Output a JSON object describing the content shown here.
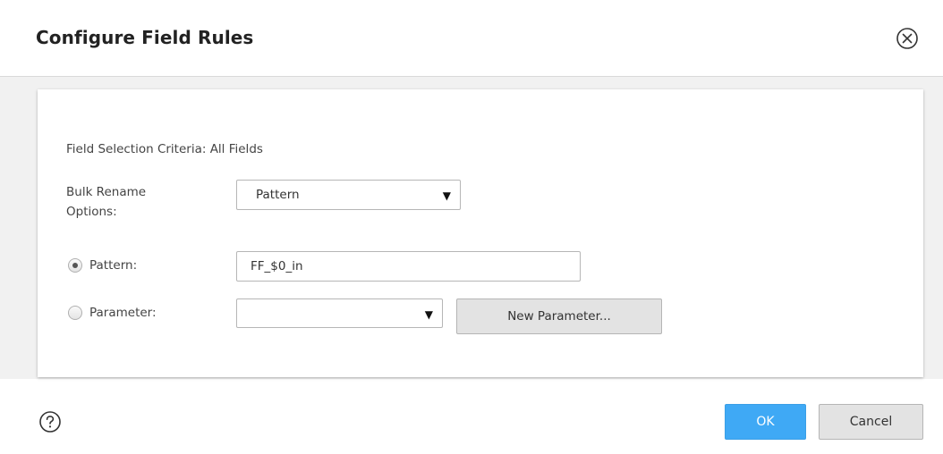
{
  "dialog": {
    "title": "Configure Field Rules",
    "close_icon": "close-circle-icon"
  },
  "form": {
    "field_selection_criteria": "Field Selection Criteria: All Fields",
    "bulk_rename_label": "Bulk Rename Options:",
    "bulk_rename_selected": "Pattern",
    "pattern_label": "Pattern:",
    "pattern_selected": true,
    "pattern_value": "FF_$0_in",
    "parameter_label": "Parameter:",
    "parameter_selected": false,
    "parameter_value": "",
    "new_parameter_label": "New Parameter..."
  },
  "footer": {
    "help_icon": "help-circle-icon",
    "ok_label": "OK",
    "cancel_label": "Cancel"
  },
  "colors": {
    "primary_button": "#3fa9f5",
    "body_background": "#f1f1f1"
  }
}
